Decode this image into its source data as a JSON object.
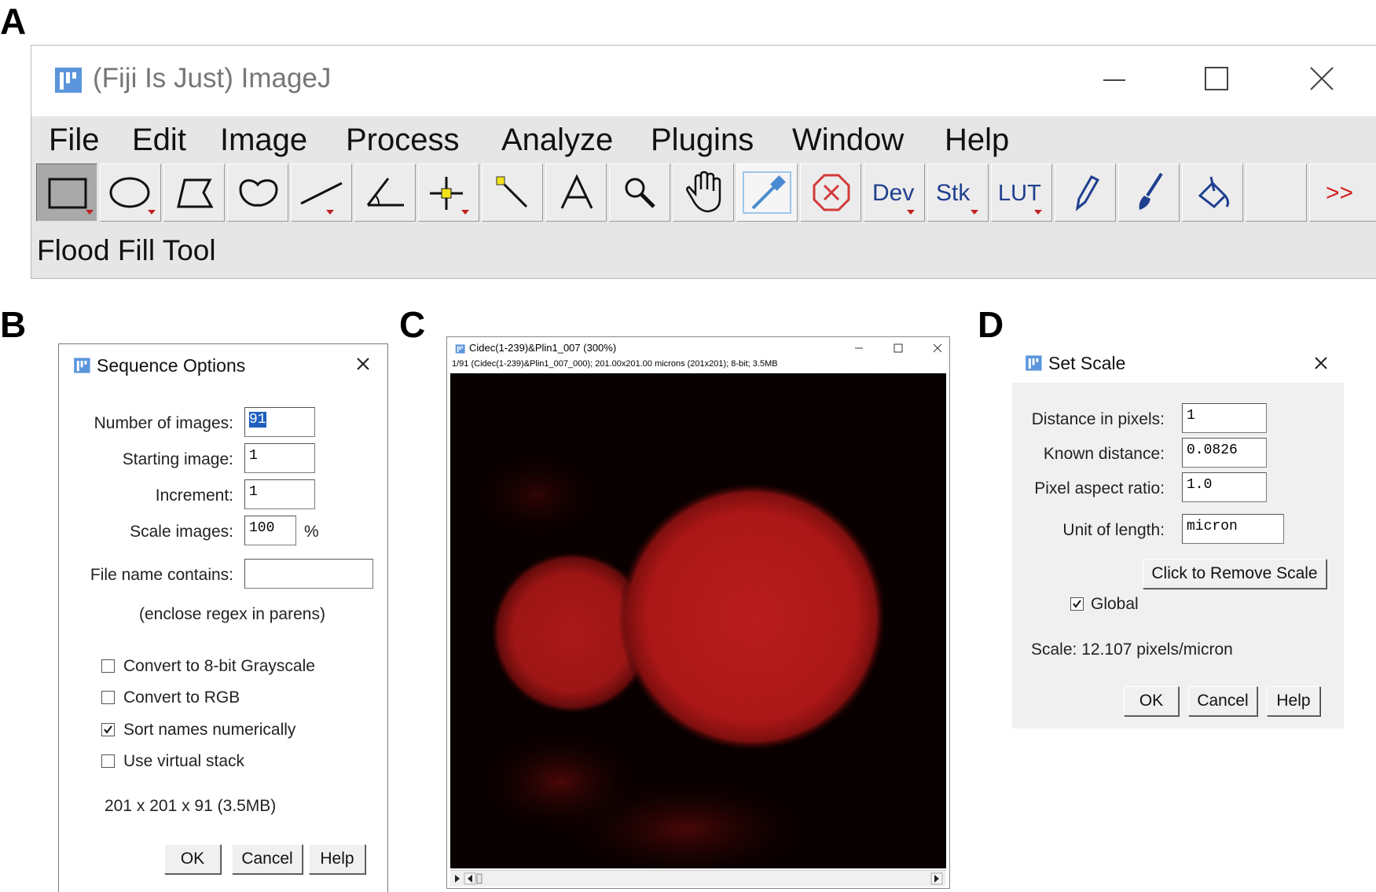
{
  "panel_labels": {
    "a": "A",
    "b": "B",
    "c": "C",
    "d": "D"
  },
  "imagej": {
    "title": "(Fiji Is Just) ImageJ",
    "menu": [
      "File",
      "Edit",
      "Image",
      "Process",
      "Analyze",
      "Plugins",
      "Window",
      "Help"
    ],
    "tools": [
      {
        "name": "rectangle",
        "icon": "rectangle-select-icon",
        "selected": true
      },
      {
        "name": "oval",
        "icon": "oval-select-icon"
      },
      {
        "name": "polygon",
        "icon": "polygon-select-icon"
      },
      {
        "name": "freehand",
        "icon": "freehand-select-icon"
      },
      {
        "name": "line",
        "icon": "line-tool-icon"
      },
      {
        "name": "angle",
        "icon": "angle-tool-icon"
      },
      {
        "name": "point",
        "icon": "point-tool-icon"
      },
      {
        "name": "wand",
        "icon": "wand-tool-icon"
      },
      {
        "name": "text",
        "icon": "text-tool-icon",
        "label": "A"
      },
      {
        "name": "magnifier",
        "icon": "magnifier-icon"
      },
      {
        "name": "hand",
        "icon": "hand-tool-icon"
      },
      {
        "name": "color-picker",
        "icon": "color-picker-icon"
      },
      {
        "name": "close-all",
        "icon": "close-all-icon"
      },
      {
        "name": "dev",
        "icon": "dev-menu-icon",
        "label": "Dev"
      },
      {
        "name": "stk",
        "icon": "stack-menu-icon",
        "label": "Stk"
      },
      {
        "name": "lut",
        "icon": "lut-menu-icon",
        "label": "LUT"
      },
      {
        "name": "pencil",
        "icon": "pencil-icon"
      },
      {
        "name": "brush",
        "icon": "brush-icon"
      },
      {
        "name": "flood-fill",
        "icon": "flood-fill-icon"
      },
      {
        "name": "empty",
        "icon": ""
      },
      {
        "name": "more",
        "icon": "more-tools-icon",
        "label": ">>"
      }
    ],
    "status": "Flood Fill Tool"
  },
  "sequence_options": {
    "title": "Sequence Options",
    "number_of_images_label": "Number of images:",
    "number_of_images_value": "91",
    "starting_image_label": "Starting image:",
    "starting_image_value": "1",
    "increment_label": "Increment:",
    "increment_value": "1",
    "scale_images_label": "Scale images:",
    "scale_images_value": "100",
    "scale_unit": "%",
    "file_name_label": "File name contains:",
    "file_name_value": "",
    "regex_hint": "(enclose regex in parens)",
    "checkboxes": [
      {
        "label": "Convert to 8-bit Grayscale",
        "checked": false
      },
      {
        "label": "Convert to RGB",
        "checked": false
      },
      {
        "label": "Sort names numerically",
        "checked": true
      },
      {
        "label": "Use virtual stack",
        "checked": false
      }
    ],
    "size_info": "201 x 201 x 91 (3.5MB)",
    "ok": "OK",
    "cancel": "Cancel",
    "help": "Help"
  },
  "image_window": {
    "title": "Cidec(1-239)&Plin1_007 (300%)",
    "subtitle": "1/91 (Cidec(1-239)&Plin1_007_000); 201.00x201.00 microns (201x201); 8-bit; 3.5MB",
    "colors": {
      "background": "#0b0000",
      "signal": "#d41f1f"
    }
  },
  "set_scale": {
    "title": "Set Scale",
    "distance_label": "Distance in pixels:",
    "distance_value": "1",
    "known_label": "Known distance:",
    "known_value": "0.0826",
    "aspect_label": "Pixel aspect ratio:",
    "aspect_value": "1.0",
    "unit_label": "Unit of length:",
    "unit_value": "micron",
    "remove_scale": "Click to Remove Scale",
    "global_label": "Global",
    "global_checked": true,
    "scale_text": "Scale: 12.107 pixels/micron",
    "ok": "OK",
    "cancel": "Cancel",
    "help": "Help"
  },
  "colors": {
    "fiji_blue": "#3a7bd5",
    "toolbar_bg": "#e6e6e6",
    "close_all_red": "#d23a3a",
    "more_red": "#d02020"
  }
}
